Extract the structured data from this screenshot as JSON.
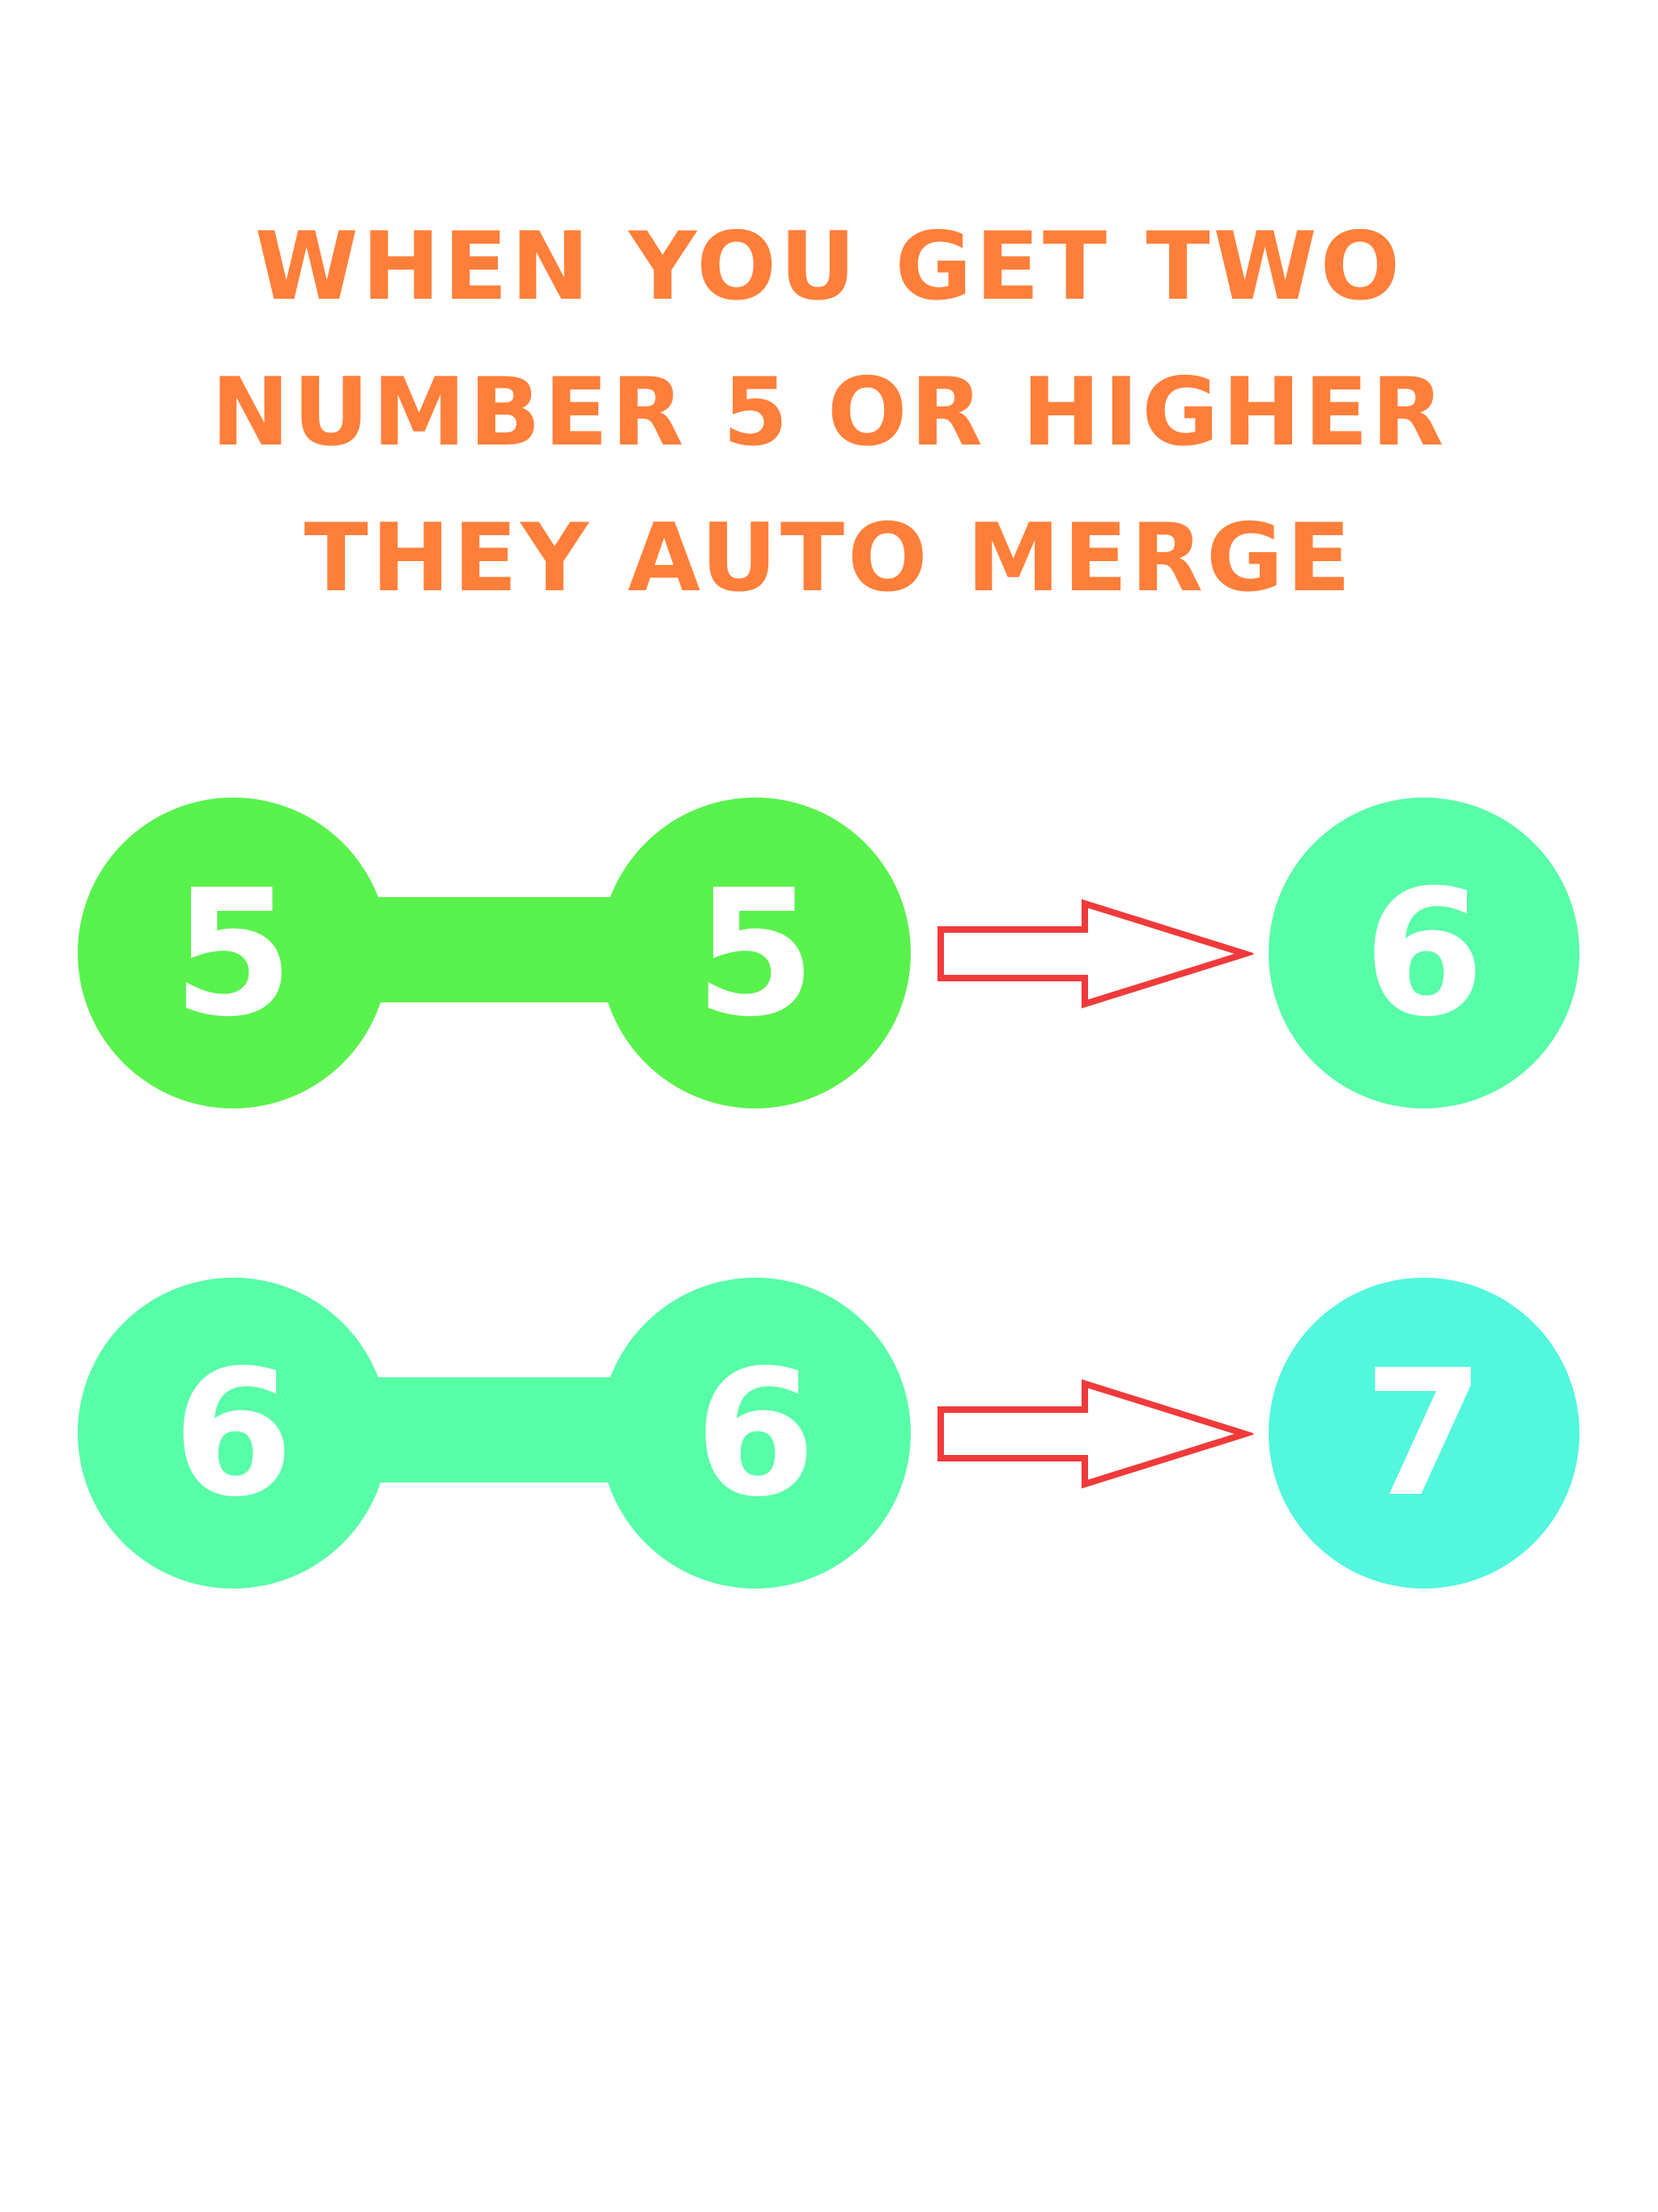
{
  "headline": {
    "line1": "WHEN YOU GET TWO",
    "line2": "NUMBER 5 OR HIGHER",
    "line3": "THEY AUTO MERGE"
  },
  "colors": {
    "headline": "#ff7f3a",
    "arrow_outline": "#f03a3a",
    "ball_5": "#59f24d",
    "ball_6": "#58fda8",
    "ball_7": "#52f7dd",
    "number_text": "#ffffff"
  },
  "merges": [
    {
      "input_left": "5",
      "input_right": "5",
      "input_color": "#59f24d",
      "result": "6",
      "result_color": "#58fda8",
      "arrow_icon": "arrow-right-icon"
    },
    {
      "input_left": "6",
      "input_right": "6",
      "input_color": "#58fda8",
      "result": "7",
      "result_color": "#52f7dd",
      "arrow_icon": "arrow-right-icon"
    }
  ]
}
